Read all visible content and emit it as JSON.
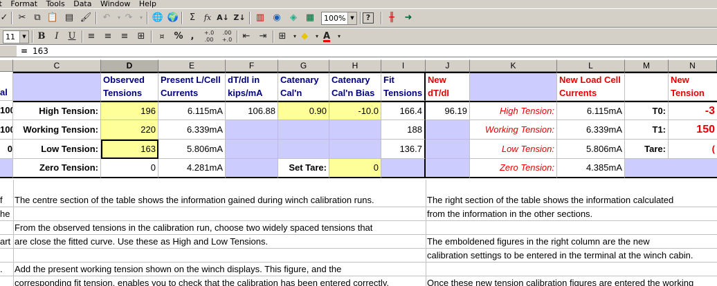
{
  "menu": [
    "rt",
    "Format",
    "Tools",
    "Data",
    "Window",
    "Help"
  ],
  "toolbar": {
    "zoom": "100%",
    "font_size": "11",
    "bold": "B",
    "italic": "I",
    "underline": "U",
    "percent": "%",
    "comma": ",",
    "inc_decimal": "+.0 .00",
    "dec_decimal": ".00 +.0",
    "sum": "Σ",
    "fx": "fx",
    "font_color_letter": "A"
  },
  "formula_bar": {
    "equals": "=",
    "value": "163"
  },
  "columns": [
    "C",
    "D",
    "E",
    "F",
    "G",
    "H",
    "I",
    "J",
    "K",
    "L",
    "M",
    "N"
  ],
  "table": {
    "headers": {
      "D": "Observed Tensions",
      "E": "Present L/Cell Currents",
      "F": "dT/dI  in kips/mA",
      "G": "Catenary Cal'n Scale",
      "H": "Catenary Cal'n Bias",
      "I": "Fit Tensions",
      "J": "New dT/dI",
      "L": "New Load Cell Currents",
      "N": "New Tension Ca"
    },
    "left_fragments": [
      "al",
      "100",
      "100",
      "0"
    ],
    "rows": [
      {
        "label": "High Tension:",
        "observed": "196",
        "current": "6.115mA",
        "dtdi": "106.88",
        "scale": "0.90",
        "bias": "-10.0",
        "fit": "166.4",
        "new_dtdi": "96.19",
        "k_label": "High Tension:",
        "new_current": "6.115mA",
        "m_label": "T0:",
        "n_val": "-3"
      },
      {
        "label": "Working Tension:",
        "observed": "220",
        "current": "6.339mA",
        "dtdi": "",
        "scale": "",
        "bias": "",
        "fit": "188",
        "new_dtdi": "",
        "k_label": "Working Tension:",
        "new_current": "6.339mA",
        "m_label": "T1:",
        "n_val": "150"
      },
      {
        "label": "Low Tension:",
        "observed": "163",
        "current": "5.806mA",
        "dtdi": "",
        "scale": "",
        "bias": "",
        "fit": "136.7",
        "new_dtdi": "",
        "k_label": "Low Tension:",
        "new_current": "5.806mA",
        "m_label": "Tare:",
        "n_val": "("
      },
      {
        "label": "Zero Tension:",
        "observed": "0",
        "current": "4.281mA",
        "dtdi": "",
        "scale": "Set Tare:",
        "bias": "0",
        "fit": "",
        "new_dtdi": "",
        "k_label": "Zero Tension:",
        "new_current": "4.385mA",
        "m_label": "",
        "n_val": ""
      }
    ]
  },
  "notes": {
    "left_margin": [
      "f",
      "he",
      "",
      "art",
      "",
      "."
    ],
    "center": [
      "The centre section of the table shows the information gained during winch calibration runs.",
      "",
      "From the observed tensions in the calibration run, choose two widely spaced tensions that",
      "are close the fitted curve. Use these as High and Low Tensions.",
      "",
      "Add the present working tension shown on the winch displays. This figure, and the",
      "corresponding fit tension, enables you to check that the calibration has been entered correctly."
    ],
    "right": [
      "The right section of the table shows the information calculated",
      "from the information in the other sections.",
      "",
      "The emboldened figures in the right column are the new",
      "calibration settings to be entered in the terminal at the winch cabin.",
      "",
      "Once these new tension calibration figures are entered the working"
    ]
  },
  "colors": {
    "input_yellow": "#ffff99",
    "lavender": "#ccccff",
    "header_blue": "#000080",
    "red": "#e60000"
  }
}
